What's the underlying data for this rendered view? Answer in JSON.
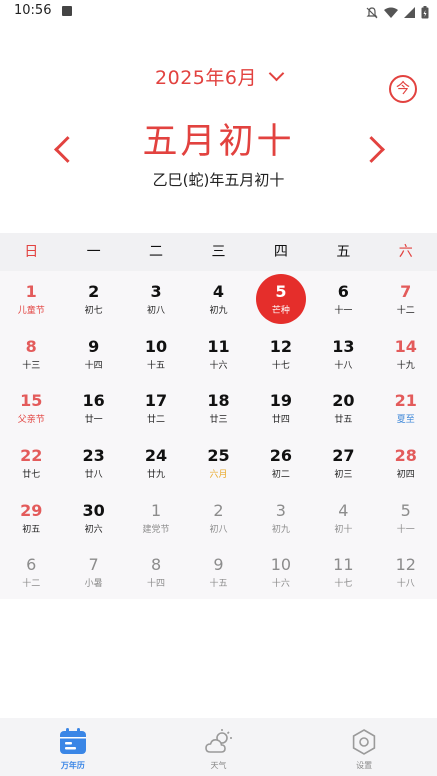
{
  "status_bar": {
    "time": "10:56"
  },
  "header": {
    "month_selector": "2025年6月",
    "lunar_date_big": "五月初十",
    "ganzhi_line": "乙巳(蛇)年五月初十",
    "today_label": "今"
  },
  "weekdays": [
    "日",
    "一",
    "二",
    "三",
    "四",
    "五",
    "六"
  ],
  "days": [
    {
      "num": "1",
      "sub": "儿童节"
    },
    {
      "num": "2",
      "sub": "初七"
    },
    {
      "num": "3",
      "sub": "初八"
    },
    {
      "num": "4",
      "sub": "初九"
    },
    {
      "num": "5",
      "sub": "芒种"
    },
    {
      "num": "6",
      "sub": "十一"
    },
    {
      "num": "7",
      "sub": "十二"
    },
    {
      "num": "8",
      "sub": "十三"
    },
    {
      "num": "9",
      "sub": "十四"
    },
    {
      "num": "10",
      "sub": "十五"
    },
    {
      "num": "11",
      "sub": "十六"
    },
    {
      "num": "12",
      "sub": "十七"
    },
    {
      "num": "13",
      "sub": "十八"
    },
    {
      "num": "14",
      "sub": "十九"
    },
    {
      "num": "15",
      "sub": "父亲节"
    },
    {
      "num": "16",
      "sub": "廿一"
    },
    {
      "num": "17",
      "sub": "廿二"
    },
    {
      "num": "18",
      "sub": "廿三"
    },
    {
      "num": "19",
      "sub": "廿四"
    },
    {
      "num": "20",
      "sub": "廿五"
    },
    {
      "num": "21",
      "sub": "夏至"
    },
    {
      "num": "22",
      "sub": "廿七"
    },
    {
      "num": "23",
      "sub": "廿八"
    },
    {
      "num": "24",
      "sub": "廿九"
    },
    {
      "num": "25",
      "sub": "六月"
    },
    {
      "num": "26",
      "sub": "初二"
    },
    {
      "num": "27",
      "sub": "初三"
    },
    {
      "num": "28",
      "sub": "初四"
    },
    {
      "num": "29",
      "sub": "初五"
    },
    {
      "num": "30",
      "sub": "初六"
    },
    {
      "num": "1",
      "sub": "建党节"
    },
    {
      "num": "2",
      "sub": "初八"
    },
    {
      "num": "3",
      "sub": "初九"
    },
    {
      "num": "4",
      "sub": "初十"
    },
    {
      "num": "5",
      "sub": "十一"
    },
    {
      "num": "6",
      "sub": "十二"
    },
    {
      "num": "7",
      "sub": "小暑"
    },
    {
      "num": "8",
      "sub": "十四"
    },
    {
      "num": "9",
      "sub": "十五"
    },
    {
      "num": "10",
      "sub": "十六"
    },
    {
      "num": "11",
      "sub": "十七"
    },
    {
      "num": "12",
      "sub": "十八"
    }
  ],
  "bottom_nav": [
    {
      "label": "万年历",
      "icon": "calendar-icon",
      "active": true
    },
    {
      "label": "天气",
      "icon": "weather-icon",
      "active": false
    },
    {
      "label": "设置",
      "icon": "settings-icon",
      "active": false
    }
  ],
  "colors": {
    "accent": "#e2423f",
    "selected": "#e52e2b",
    "nav_active": "#3a86e6",
    "solar_term_blue": "#3b86d8",
    "lunar_month_yellow": "#e9a92a"
  }
}
